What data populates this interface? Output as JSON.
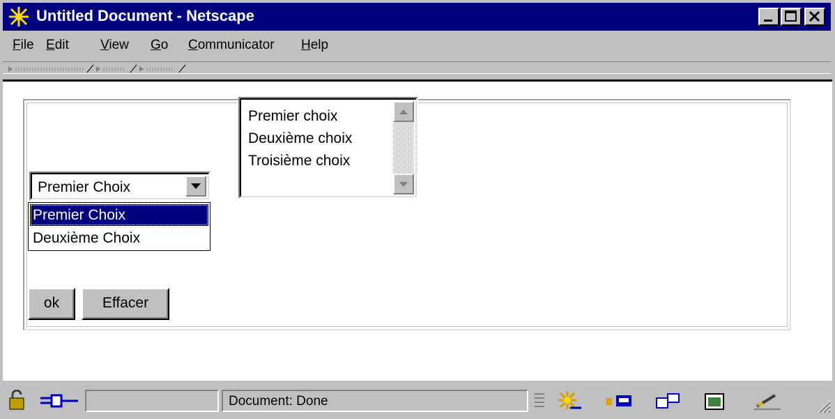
{
  "window": {
    "title": "Untitled Document - Netscape"
  },
  "menu": [
    {
      "pre": "",
      "u": "F",
      "post": "ile"
    },
    {
      "pre": "",
      "u": "E",
      "post": "dit"
    },
    {
      "pre": "",
      "u": "V",
      "post": "iew"
    },
    {
      "pre": "",
      "u": "G",
      "post": "o"
    },
    {
      "pre": "",
      "u": "C",
      "post": "ommunicator"
    },
    {
      "pre": "",
      "u": "H",
      "post": "elp"
    }
  ],
  "listbox": {
    "options": [
      "Premier choix",
      "Deuxième choix",
      "Troisième choix"
    ]
  },
  "select": {
    "value": "Premier Choix",
    "options": [
      "Premier Choix",
      "Deuxième Choix"
    ],
    "highlighted_index": 0
  },
  "buttons": {
    "ok": "ok",
    "reset": "Effacer"
  },
  "status": {
    "text": "Document: Done"
  },
  "icons": {
    "app": "netscape-logo-icon",
    "security": "padlock-icon",
    "connection": "plug-icon",
    "components": [
      "navigator-icon",
      "mailbox-icon",
      "discussion-icon",
      "composer-icon",
      "pen-icon"
    ]
  },
  "colors": {
    "titlebar": "#000080",
    "selection": "#000080",
    "chrome": "#c0c0c0"
  }
}
